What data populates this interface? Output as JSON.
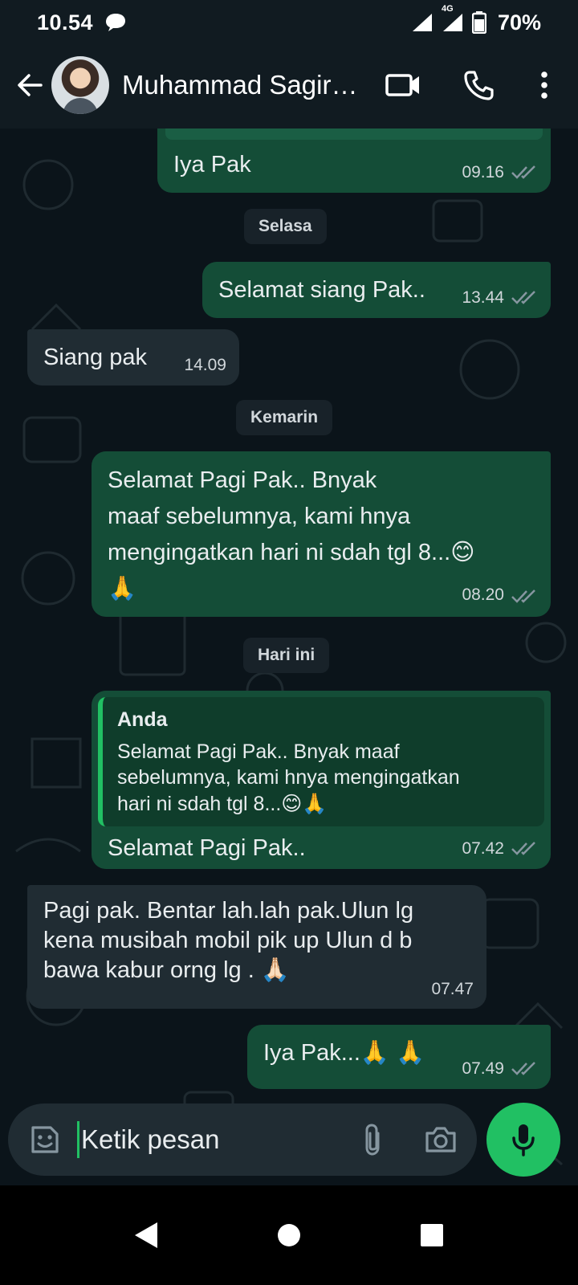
{
  "status_bar": {
    "time": "10.54",
    "network": "4G",
    "battery": "70%"
  },
  "header": {
    "contact_name": "Muhammad Sagir…"
  },
  "colors": {
    "outgoing_bubble": "#144d37",
    "incoming_bubble": "#202c33",
    "accent": "#21c063",
    "background": "#0b141a"
  },
  "messages": [
    {
      "type": "outgoing",
      "text": "Iya Pak",
      "time": "09.16"
    },
    {
      "type": "date",
      "text": "Selasa"
    },
    {
      "type": "outgoing",
      "text": "Selamat siang Pak..",
      "time": "13.44"
    },
    {
      "type": "incoming",
      "text": "Siang pak",
      "time": "14.09"
    },
    {
      "type": "date",
      "text": "Kemarin"
    },
    {
      "type": "outgoing",
      "text": "Selamat Pagi Pak.. Bnyak\nmaaf sebelumnya, kami hnya\nmengingatkan hari ni sdah tgl 8...😊\n🙏",
      "time": "08.20"
    },
    {
      "type": "date",
      "text": "Hari ini"
    },
    {
      "type": "outgoing_reply",
      "quote_author": "Anda",
      "quote_text": "Selamat Pagi Pak.. Bnyak maaf\nsebelumnya, kami hnya mengingatkan\nhari ni sdah tgl 8...😊🙏",
      "text": "Selamat Pagi Pak..",
      "time": "07.42"
    },
    {
      "type": "incoming",
      "text": "Pagi pak. Bentar lah.lah pak.Ulun lg\nkena musibah mobil pik up Ulun d b\nbawa kabur orng lg . 🙏🏻",
      "time": "07.47"
    },
    {
      "type": "outgoing",
      "text": "Iya Pak...🙏 🙏",
      "time": "07.49"
    }
  ],
  "composer": {
    "placeholder": "Ketik pesan"
  }
}
